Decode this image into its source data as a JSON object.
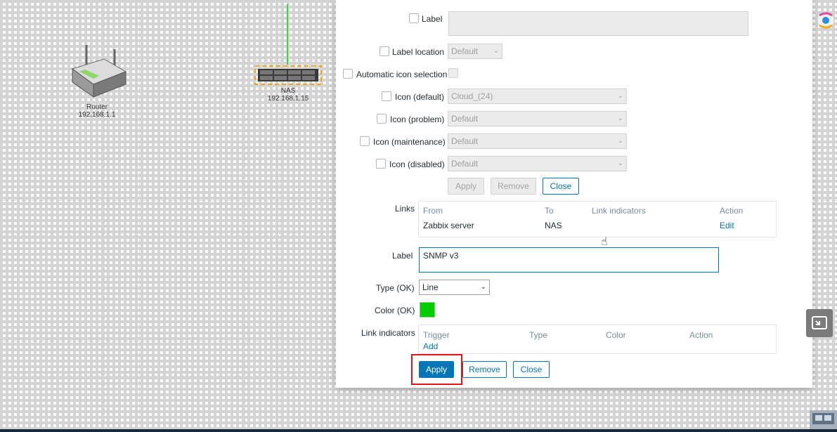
{
  "map": {
    "router": {
      "name": "Router",
      "ip": "192.168.1.1"
    },
    "nas": {
      "name": "NAS",
      "ip": "192.168.1.15"
    },
    "link_color": "#39d939"
  },
  "element_form": {
    "label_checkbox": "Label",
    "label_location_checkbox": "Label location",
    "label_location_value": "Default",
    "auto_icon_checkbox": "Automatic icon selection",
    "icon_default_checkbox": "Icon (default)",
    "icon_default_value": "Cloud_(24)",
    "icon_problem_checkbox": "Icon (problem)",
    "icon_problem_value": "Default",
    "icon_maintenance_checkbox": "Icon (maintenance)",
    "icon_maintenance_value": "Default",
    "icon_disabled_checkbox": "Icon (disabled)",
    "icon_disabled_value": "Default",
    "apply": "Apply",
    "remove": "Remove",
    "close": "Close"
  },
  "links": {
    "label": "Links",
    "headers": [
      "From",
      "To",
      "Link indicators",
      "Action"
    ],
    "rows": [
      {
        "from": "Zabbix server",
        "to": "NAS",
        "indicators": "",
        "action": "Edit"
      }
    ]
  },
  "link_form": {
    "label_label": "Label",
    "label_value": "SNMP v3",
    "type_label": "Type (OK)",
    "type_value": "Line",
    "color_label": "Color (OK)",
    "color_value": "#00cc00",
    "indicators_label": "Link indicators",
    "indicator_headers": [
      "Trigger",
      "Type",
      "Color",
      "Action"
    ],
    "add": "Add",
    "apply": "Apply",
    "remove": "Remove",
    "close": "Close"
  }
}
